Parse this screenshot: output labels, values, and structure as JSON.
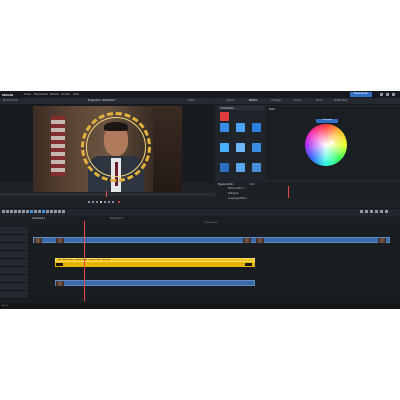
{
  "app": {
    "logo": "MAGIX",
    "menu": [
      "Datei",
      "Bearbeiten",
      "Effekte",
      "Fenster",
      "Hilfe"
    ],
    "export_label": "Exportieren",
    "project_title": "Programm: Aufnahme *",
    "timecode": "00:00:03:16",
    "zoom": "100%"
  },
  "right_tabs": [
    "Import",
    "Effekte",
    "Vorlagen",
    "Audio",
    "Store",
    "MAGIX Bibl."
  ],
  "effects": {
    "header": "Videoeffekte",
    "colors": [
      "#e23d3d",
      "#4aa3ff",
      "#2d7fe0",
      "#48b0ff",
      "#6fb8ff",
      "#3a8ee6",
      "#2b6fc2",
      "#59a8f0",
      "#4a8fd8"
    ]
  },
  "color_panel": {
    "label": "Farbe",
    "badge": "Sekundär"
  },
  "list_panel": {
    "header": "Eigenschaften",
    "col2": "Wert",
    "rows": [
      "Farbkorrektur 1",
      "Helligkeit",
      "Ausgangseffekt 1"
    ]
  },
  "timeline": {
    "tabs": [
      "Aufnahme 1",
      "Programm 2"
    ],
    "ruler_label": "00:00:04:00",
    "yellow_clip_label": "Titel: Nachrichten – Einblendung • Lower Third • Untertitel"
  },
  "status": {
    "text": "Bereit"
  }
}
